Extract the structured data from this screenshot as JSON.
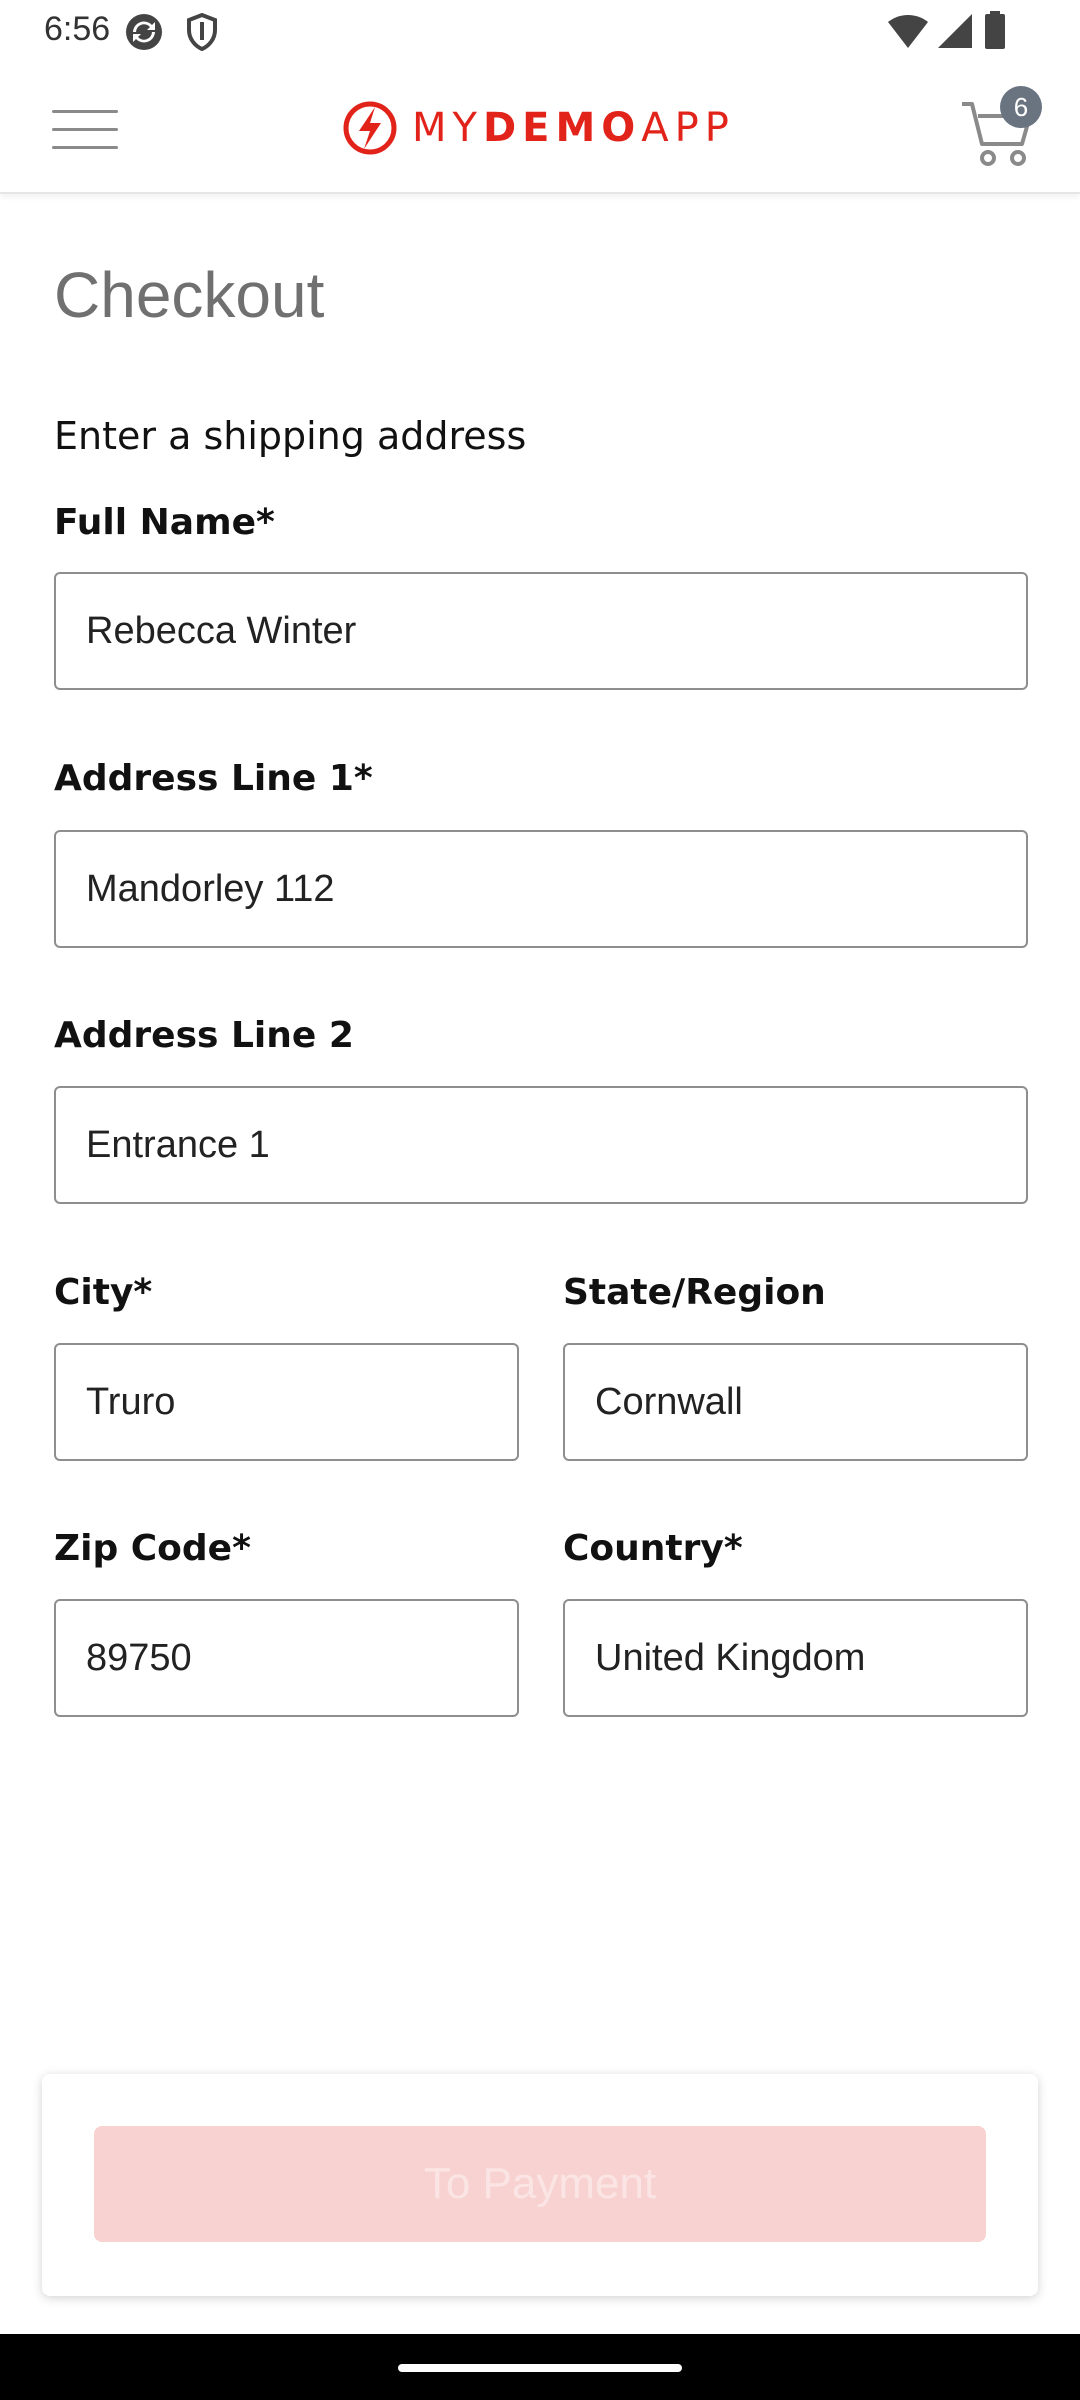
{
  "status_bar": {
    "time": "6:56"
  },
  "header": {
    "logo_light_1": "MY",
    "logo_bold": "DEMO",
    "logo_light_2": "APP",
    "cart_count": "6",
    "accent_color": "#e2231a"
  },
  "checkout": {
    "title": "Checkout",
    "section_title": "Enter a shipping address",
    "full_name": {
      "label": "Full Name*",
      "value": "Rebecca Winter"
    },
    "address_line_1": {
      "label": "Address Line 1*",
      "value": "Mandorley 112"
    },
    "address_line_2": {
      "label": "Address Line 2",
      "value": "Entrance 1"
    },
    "city": {
      "label": "City*",
      "value": "Truro"
    },
    "state_region": {
      "label": "State/Region",
      "value": "Cornwall"
    },
    "zip_code": {
      "label": "Zip Code*",
      "value": "89750"
    },
    "country": {
      "label": "Country*",
      "value": "United Kingdom"
    },
    "payment_button_label": "To Payment"
  }
}
